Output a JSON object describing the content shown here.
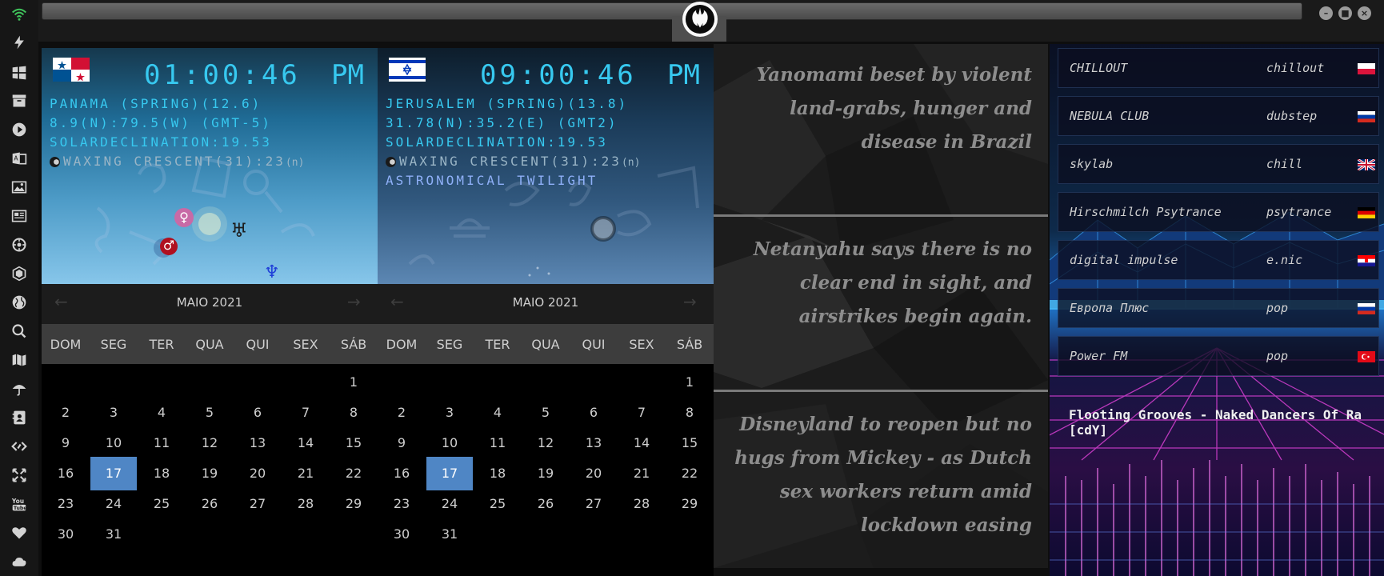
{
  "sidebar": {
    "icons": [
      "wifi-icon",
      "bolt-icon",
      "windows-icon",
      "archive-icon",
      "play-icon",
      "translate-icon",
      "image-icon",
      "news-icon",
      "settings-icon",
      "hexagon-icon",
      "globe-icon",
      "search-icon",
      "map-icon",
      "umbrella-icon",
      "contact-icon",
      "code-icon",
      "expand-icon",
      "youtube-icon",
      "heart-icon",
      "cloud-icon"
    ]
  },
  "topbar": {
    "search_value": "",
    "logo_icon": "rebel-alliance-icon"
  },
  "clocks": [
    {
      "flag": "panama-flag",
      "time": "01:00:46",
      "ampm": "PM",
      "line1": "PANAMA (SPRING)(12.6)",
      "line2": "8.9(N):79.5(W) (GMT-5)",
      "line3": "SOLARDECLINATION:19.53",
      "moon": "WAXING CRESCENT(31):23",
      "moon_suffix": "(n)",
      "extra": ""
    },
    {
      "flag": "israel-flag",
      "time": "09:00:46",
      "ampm": "PM",
      "line1": "JERUSALEM (SPRING)(13.8)",
      "line2": "31.78(N):35.2(E) (GMT2)",
      "line3": "SOLARDECLINATION:19.53",
      "moon": "WAXING CRESCENT(31):23",
      "moon_suffix": "(n)",
      "extra": "ASTRONOMICAL TWILIGHT"
    }
  ],
  "calendar": {
    "title": "MAIO 2021",
    "prev": "←",
    "next": "→",
    "day_names": [
      "DOM",
      "SEG",
      "TER",
      "QUA",
      "QUI",
      "SEX",
      "SÁB"
    ],
    "first_weekday": 6,
    "days_in_month": 31,
    "selected_day": 17
  },
  "planets": {
    "venus": "♀",
    "mars": "♂",
    "uranus": "♅",
    "neptune": "♆"
  },
  "news": [
    "Yanomami beset by violent land-grabs, hunger and disease in Brazil",
    "Netanyahu says there is no clear end in sight, and airstrikes begin again.",
    "Disneyland to reopen but no hugs from Mickey - as Dutch sex workers return amid lockdown easing"
  ],
  "radio": {
    "stations": [
      {
        "name": "CHILLOUT",
        "genre": "chillout",
        "flag": "poland-flag"
      },
      {
        "name": "NEBULA CLUB",
        "genre": "dubstep",
        "flag": "russia-flag"
      },
      {
        "name": "skylab",
        "genre": "chill",
        "flag": "uk-flag"
      },
      {
        "name": "Hirschmilch Psytrance",
        "genre": "psytrance",
        "flag": "germany-flag"
      },
      {
        "name": "digital impulse",
        "genre": "e.nic",
        "flag": "croatia-flag"
      },
      {
        "name": "Европа Плюс",
        "genre": "pop",
        "flag": "russia-flag"
      },
      {
        "name": "Power FM",
        "genre": "pop",
        "flag": "turkey-flag"
      }
    ],
    "now_playing": "Flooting Grooves - Naked Dancers Of Ra [cdY]"
  }
}
